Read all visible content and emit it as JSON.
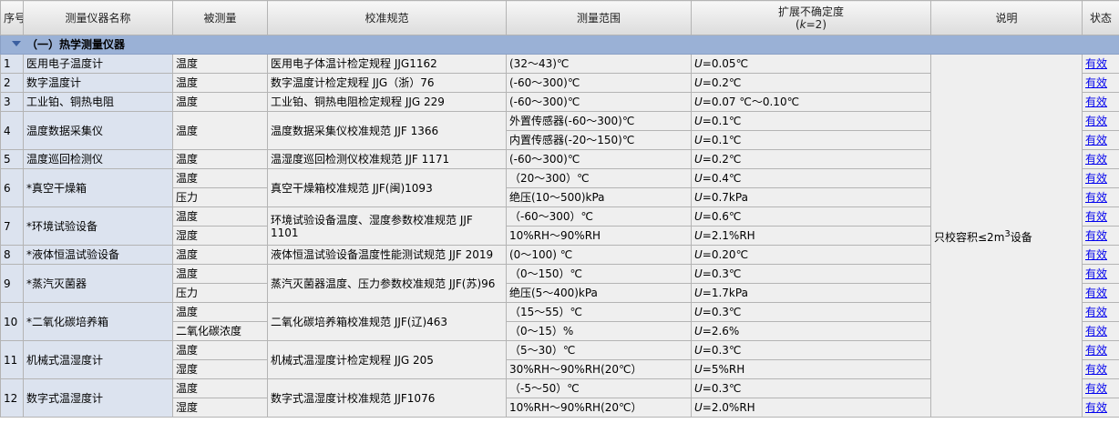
{
  "headers": {
    "seq": "序号",
    "name": "测量仪器名称",
    "quantity": "被测量",
    "spec": "校准规范",
    "range": "测量范围",
    "uncertainty_line1": "扩展不确定度",
    "uncertainty_k_prefix": "(",
    "uncertainty_k": "k",
    "uncertainty_k_suffix": "=2)",
    "note": "说明",
    "status": "状态"
  },
  "group": {
    "label": "（一）热学测量仪器"
  },
  "uncertainty_symbol": "U",
  "note": {
    "text": "只校容积≤2m",
    "superscript": "3",
    "suffix": "设备"
  },
  "rows": [
    {
      "seq": "1",
      "name": "医用电子温度计",
      "quantity": "温度",
      "spec": "医用电子体温计检定规程 JJG1162",
      "range": "(32～43)℃",
      "unc": "=0.05℃",
      "status": "有效"
    },
    {
      "seq": "2",
      "name": "数字温度计",
      "quantity": "温度",
      "spec": "数字温度计检定规程 JJG（浙）76",
      "range": "(-60～300)℃",
      "unc": "=0.2℃",
      "status": "有效"
    },
    {
      "seq": "3",
      "name": "工业铂、铜热电阻",
      "quantity": "温度",
      "spec": "工业铂、铜热电阻检定规程 JJG 229",
      "range": "(-60～300)℃",
      "unc": "=0.07 ℃～0.10℃",
      "status": "有效"
    },
    {
      "seq": "4",
      "name": "温度数据采集仪",
      "quantity": "温度",
      "spec": "温度数据采集仪校准规范 JJF 1366",
      "sub": [
        {
          "range": "外置传感器(-60～300)℃",
          "unc": "=0.1℃",
          "status": "有效"
        },
        {
          "range": "内置传感器(-20～150)℃",
          "unc": "=0.1℃",
          "status": "有效"
        }
      ]
    },
    {
      "seq": "5",
      "name": "温度巡回检测仪",
      "quantity": "温度",
      "spec": "温湿度巡回检测仪校准规范 JJF 1171",
      "range": "(-60～300)℃",
      "unc": "=0.2℃",
      "status": "有效"
    },
    {
      "seq": "6",
      "name": "*真空干燥箱",
      "spec": "真空干燥箱校准规范 JJF(闽)1093",
      "sub": [
        {
          "quantity": "温度",
          "range": "（20～300）℃",
          "unc": "=0.4℃",
          "status": "有效"
        },
        {
          "quantity": "压力",
          "range": "绝压(10～500)kPa",
          "unc": "=0.7kPa",
          "status": "有效"
        }
      ]
    },
    {
      "seq": "7",
      "name": "*环境试验设备",
      "spec": "环境试验设备温度、湿度参数校准规范 JJF 1101",
      "sub": [
        {
          "quantity": "温度",
          "range": "（-60～300）℃",
          "unc": "=0.6℃",
          "status": "有效"
        },
        {
          "quantity": "湿度",
          "range": "10%RH～90%RH",
          "unc": "=2.1%RH",
          "status": "有效"
        }
      ]
    },
    {
      "seq": "8",
      "name": "*液体恒温试验设备",
      "quantity": "温度",
      "spec": "液体恒温试验设备温度性能测试规范 JJF 2019",
      "range": "(0～100) ℃",
      "unc": "=0.20℃",
      "status": "有效"
    },
    {
      "seq": "9",
      "name": "*蒸汽灭菌器",
      "spec": "蒸汽灭菌器温度、压力参数校准规范 JJF(苏)96",
      "sub": [
        {
          "quantity": "温度",
          "range": "（0～150）℃",
          "unc": "=0.3℃",
          "status": "有效"
        },
        {
          "quantity": "压力",
          "range": "绝压(5～400)kPa",
          "unc": "=1.7kPa",
          "status": "有效"
        }
      ]
    },
    {
      "seq": "10",
      "name": "*二氧化碳培养箱",
      "spec": "二氧化碳培养箱校准规范 JJF(辽)463",
      "sub": [
        {
          "quantity": "温度",
          "range": "（15～55）℃",
          "unc": "=0.3℃",
          "status": "有效"
        },
        {
          "quantity": "二氧化碳浓度",
          "range": "（0～15）%",
          "unc": "=2.6%",
          "status": "有效"
        }
      ]
    },
    {
      "seq": "11",
      "name": "机械式温湿度计",
      "spec": "机械式温湿度计检定规程 JJG 205",
      "sub": [
        {
          "quantity": "温度",
          "range": "（5～30）℃",
          "unc": "=0.3℃",
          "status": "有效"
        },
        {
          "quantity": "湿度",
          "range": "30%RH～90%RH(20℃）",
          "unc": "=5%RH",
          "status": "有效"
        }
      ]
    },
    {
      "seq": "12",
      "name": "数字式温湿度计",
      "spec": "数字式温湿度计校准规范 JJF1076",
      "sub": [
        {
          "quantity": "温度",
          "range": "（-5～50）℃",
          "unc": "=0.3℃",
          "status": "有效"
        },
        {
          "quantity": "湿度",
          "range": "10%RH～90%RH(20℃）",
          "unc": "=2.0%RH",
          "status": "有效"
        }
      ]
    }
  ]
}
